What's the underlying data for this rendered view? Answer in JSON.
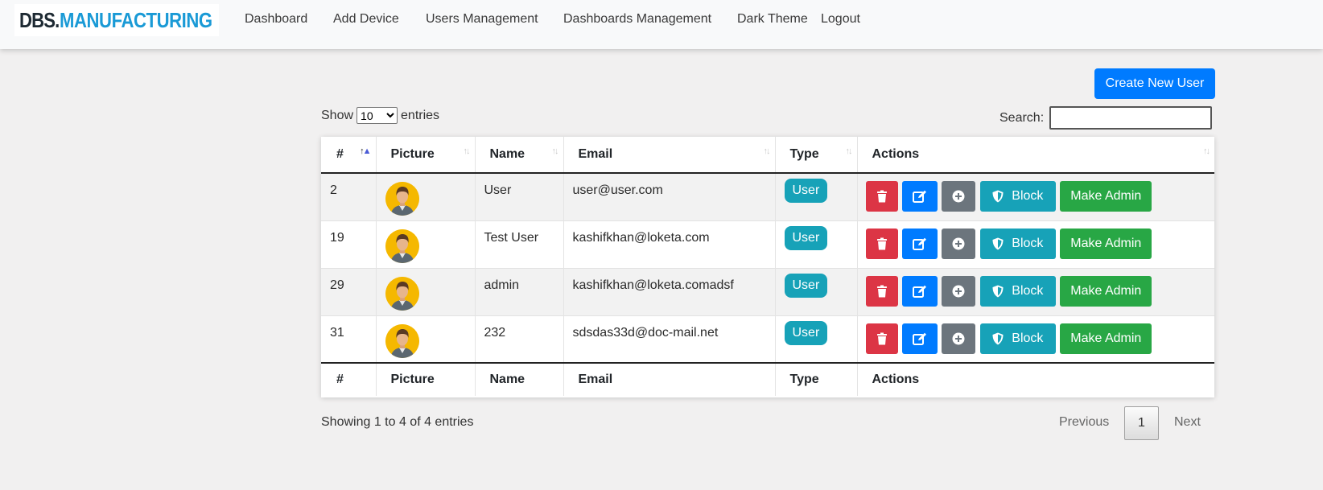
{
  "logo": {
    "part1": "DBS.",
    "part2": "MANUFACTURING"
  },
  "nav": {
    "dashboard": "Dashboard",
    "add_device": "Add Device",
    "users_management": "Users Management",
    "dashboards_management": "Dashboards Management",
    "dark_theme": "Dark Theme",
    "logout": "Logout"
  },
  "toolbar": {
    "create_button": "Create New User",
    "show_label": "Show",
    "entries_label": "entries",
    "page_size": "10",
    "search_label": "Search:"
  },
  "table": {
    "columns": [
      "#",
      "Picture",
      "Name",
      "Email",
      "Type",
      "Actions"
    ],
    "rows": [
      {
        "id": "2",
        "name": "User",
        "email": "user@user.com",
        "type": "User"
      },
      {
        "id": "19",
        "name": "Test User",
        "email": "kashifkhan@loketa.com",
        "type": "User"
      },
      {
        "id": "29",
        "name": "admin",
        "email": "kashifkhan@loketa.comadsf",
        "type": "User"
      },
      {
        "id": "31",
        "name": "232",
        "email": "sdsdas33d@doc-mail.net",
        "type": "User"
      }
    ],
    "actions": {
      "block": "Block",
      "make_admin": "Make Admin"
    }
  },
  "footer": {
    "info": "Showing 1 to 4 of 4 entries",
    "previous": "Previous",
    "page": "1",
    "next": "Next"
  },
  "colors": {
    "primary": "#007bff",
    "danger": "#dc3545",
    "secondary": "#6c757d",
    "info": "#17a2b8",
    "success": "#28a745",
    "avatar": "#f5b800"
  },
  "icons": [
    "trash-icon",
    "edit-icon",
    "plus-circle-icon",
    "shield-icon",
    "sort-icon",
    "user-avatar-icon"
  ]
}
